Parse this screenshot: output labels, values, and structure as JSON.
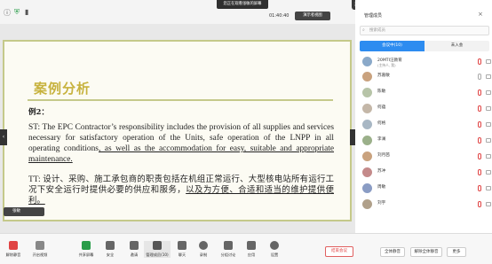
{
  "topbar": {
    "watch_tip": "您正在观看张敏的屏幕",
    "timer": "01:40:40",
    "present_view": "演示者视图",
    "speaker": "正在讲话: 苏嘉敏"
  },
  "slide": {
    "title": "案例分析",
    "example_label": "例2：",
    "st_plain": "ST: The EPC Contractor’s responsibility includes the provision of all supplies and services necessary for satisfactory operation of the Units, safe operation of the LNPP in all operating conditions",
    "st_underlined": ", as well as the accommodation for easy, suitable and appropriate maintenance.",
    "tt_plain": "TT: 设计、采购、施工承包商的职责包括在机组正常运行、大型核电站所有运行工况下安全运行时提供必要的供应和服务，",
    "tt_underlined": "以及为方便、合适和适当的维护提供便利。",
    "presenter_tag": "张敏"
  },
  "panel": {
    "title": "管理成员",
    "search_placeholder": "搜索成员",
    "tab_in": "会议中(10)",
    "tab_out": "未入会",
    "members": [
      {
        "name": "20MTI汪教育",
        "sub": "(主持人, 我)"
      },
      {
        "name": "苏嘉敏",
        "sub": ""
      },
      {
        "name": "陈敏",
        "sub": ""
      },
      {
        "name": "何蕴",
        "sub": ""
      },
      {
        "name": "何格",
        "sub": ""
      },
      {
        "name": "李澜",
        "sub": ""
      },
      {
        "name": "刘月茜",
        "sub": ""
      },
      {
        "name": "苏冲",
        "sub": ""
      },
      {
        "name": "周敏",
        "sub": ""
      },
      {
        "name": "刘宇",
        "sub": ""
      }
    ],
    "buttons": {
      "mute_all": "全体静音",
      "unmute_all": "解除全体静音",
      "more": "更多"
    }
  },
  "toolbar": {
    "items": [
      {
        "label": "解除静音",
        "icon": "mic-icon"
      },
      {
        "label": "开启视频",
        "icon": "camera-icon"
      },
      {
        "label": "共享屏幕",
        "icon": "share-screen-icon"
      },
      {
        "label": "安全",
        "icon": "shield-icon"
      },
      {
        "label": "邀请",
        "icon": "invite-icon"
      },
      {
        "label": "管理成员(10)",
        "icon": "members-icon"
      },
      {
        "label": "聊天",
        "icon": "chat-icon"
      },
      {
        "label": "录制",
        "icon": "record-icon"
      },
      {
        "label": "分组讨论",
        "icon": "breakout-icon"
      },
      {
        "label": "应用",
        "icon": "apps-icon"
      },
      {
        "label": "设置",
        "icon": "settings-icon"
      }
    ],
    "end_label": "结束会议"
  },
  "colors": {
    "accent": "#2d8cf0",
    "slide_title": "#c7b23e",
    "slide_border": "#c5c98a",
    "end_red": "#e04444"
  }
}
